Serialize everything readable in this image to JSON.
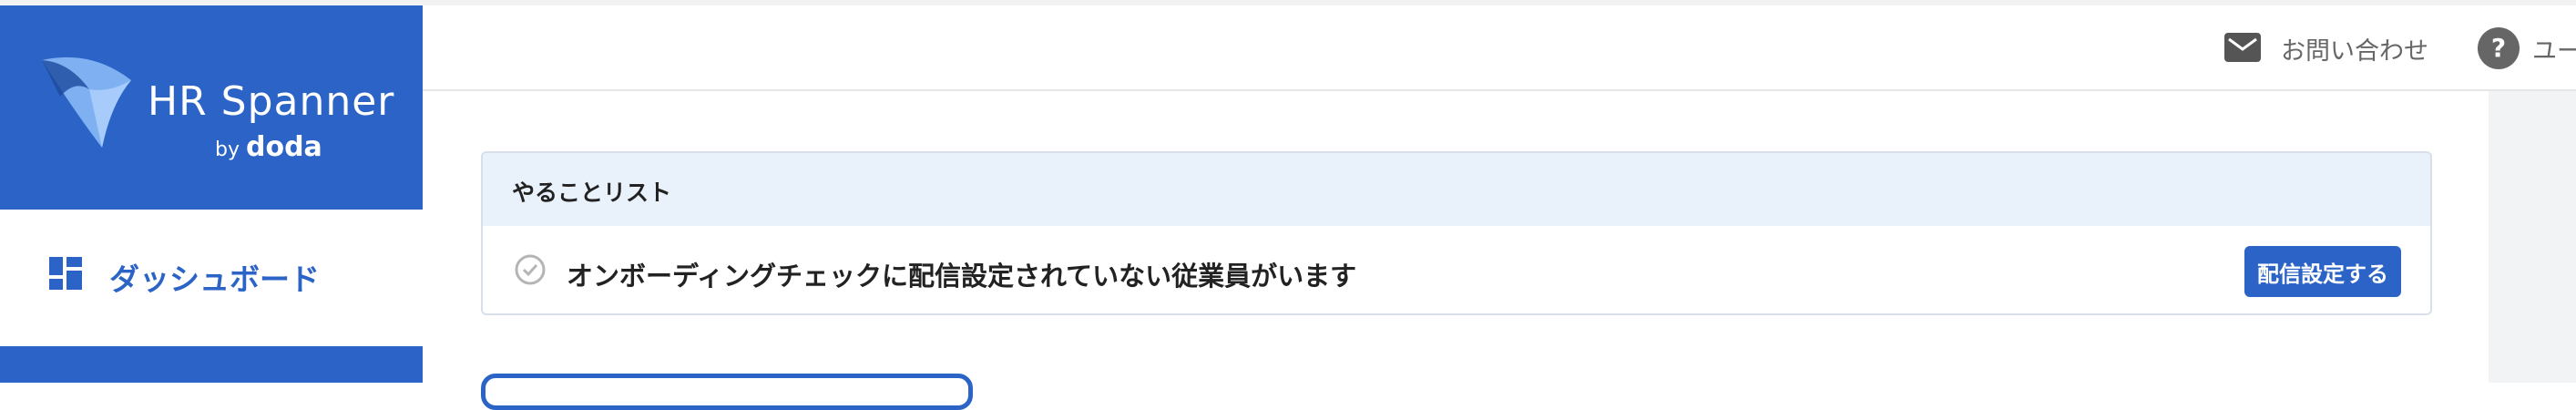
{
  "sidebar": {
    "brand": "HR Spanner",
    "by": "by",
    "doda": "doda",
    "items": [
      {
        "label": "ダッシュボード",
        "icon": "dashboard-icon"
      }
    ]
  },
  "header": {
    "contact_label": "お問い合わせ",
    "contact_icon": "mail-icon",
    "help_label": "ユー",
    "help_icon": "help-icon"
  },
  "todo": {
    "title": "やることリスト",
    "items": [
      {
        "text": "オンボーディングチェックに配信設定されていない従業員がいます",
        "button": "配信設定する"
      }
    ]
  },
  "colors": {
    "brand": "#2b64c6",
    "todo_header_bg": "#e9f1fb"
  }
}
